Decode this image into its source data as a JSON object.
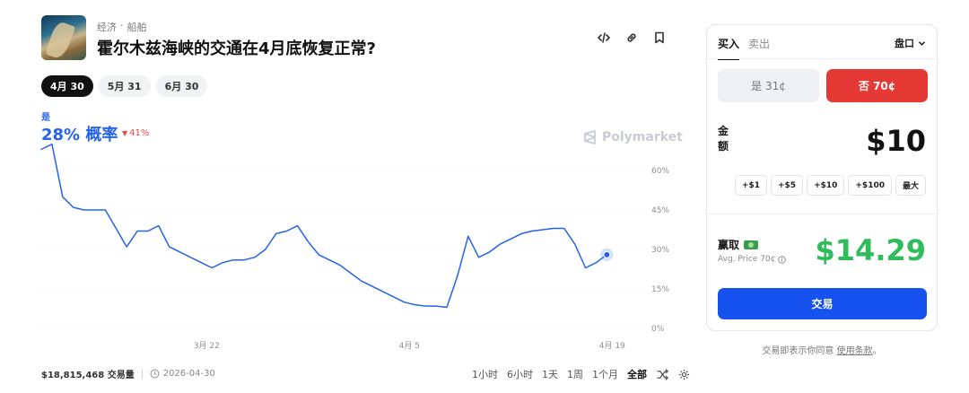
{
  "header": {
    "category": "经济",
    "separator": "·",
    "subcategory": "船舶",
    "title": "霍尔木兹海峡的交通在4月底恢复正常?",
    "actions": [
      "embed-icon",
      "link-icon",
      "bookmark-icon"
    ]
  },
  "date_tabs": [
    {
      "label": "4月 30",
      "active": true
    },
    {
      "label": "5月 31",
      "active": false
    },
    {
      "label": "6月 30",
      "active": false
    }
  ],
  "probability": {
    "outcome_label": "是",
    "value_text": "28% 概率",
    "change_text": "41%",
    "change_direction": "down"
  },
  "watermark": "Polymarket",
  "chart_data": {
    "type": "line",
    "series": [
      {
        "color": "#2563eb",
        "x": [
          0,
          1,
          2,
          3,
          4,
          5,
          6,
          7,
          8,
          9,
          10,
          11,
          12,
          13,
          14,
          15,
          16,
          17,
          18,
          19,
          20,
          21,
          22,
          23,
          24,
          25,
          26,
          27,
          28,
          29,
          30,
          31,
          32,
          33,
          34,
          35,
          36,
          37,
          38,
          39,
          40,
          41,
          42,
          43,
          44,
          45,
          46,
          47,
          48,
          49,
          50,
          51,
          52,
          53
        ],
        "values": [
          68,
          70,
          50,
          46,
          45,
          45,
          45,
          38,
          31,
          37,
          37,
          39,
          31,
          29,
          27,
          25,
          23,
          25,
          26,
          26,
          27,
          30,
          36,
          37,
          39,
          33,
          28,
          26,
          24,
          21,
          18,
          16,
          14,
          12,
          10,
          9,
          8.5,
          8.5,
          8,
          20,
          35,
          27,
          29,
          32,
          34,
          36,
          37,
          37.5,
          38,
          38,
          32,
          23,
          25,
          28
        ]
      }
    ],
    "x_tick_labels": [
      {
        "label": "3月 22",
        "x": 15.5
      },
      {
        "label": "4月 5",
        "x": 34.5
      },
      {
        "label": "4月 19",
        "x": 53.5
      }
    ],
    "xlim": [
      0,
      56.5
    ],
    "y_ticks": [
      0,
      15,
      30,
      45,
      60
    ],
    "y_tick_labels": [
      "0%",
      "15%",
      "30%",
      "45%",
      "60%"
    ],
    "ylim": [
      0,
      60
    ],
    "grid": true,
    "last_point_marker": true
  },
  "footer": {
    "volume": "$18,815,468 交易量",
    "date": "2026-04-30",
    "ranges": [
      {
        "label": "1小时",
        "active": false
      },
      {
        "label": "6小时",
        "active": false
      },
      {
        "label": "1天",
        "active": false
      },
      {
        "label": "1周",
        "active": false
      },
      {
        "label": "1个月",
        "active": false
      },
      {
        "label": "全部",
        "active": true
      }
    ]
  },
  "trade": {
    "tabs": [
      {
        "label": "买入",
        "active": true
      },
      {
        "label": "卖出",
        "active": false
      }
    ],
    "order_type": "盘口",
    "yes_button": "是 31¢",
    "no_button": "否 70¢",
    "amount_label": "金额",
    "amount_value": "$10",
    "quick_amounts": [
      "+$1",
      "+$5",
      "+$10",
      "+$100",
      "最大"
    ],
    "to_win_label": "赢取",
    "avg_price": "Avg. Price 70¢",
    "to_win_value": "$14.29",
    "trade_button": "交易",
    "terms_prefix": "交易即表示你同意",
    "terms_link": "使用条款",
    "terms_suffix": "。"
  },
  "colors": {
    "accent_blue": "#2563eb",
    "no_red": "#e53935",
    "win_green": "#2ebd5a",
    "trade_blue": "#1652f0"
  }
}
